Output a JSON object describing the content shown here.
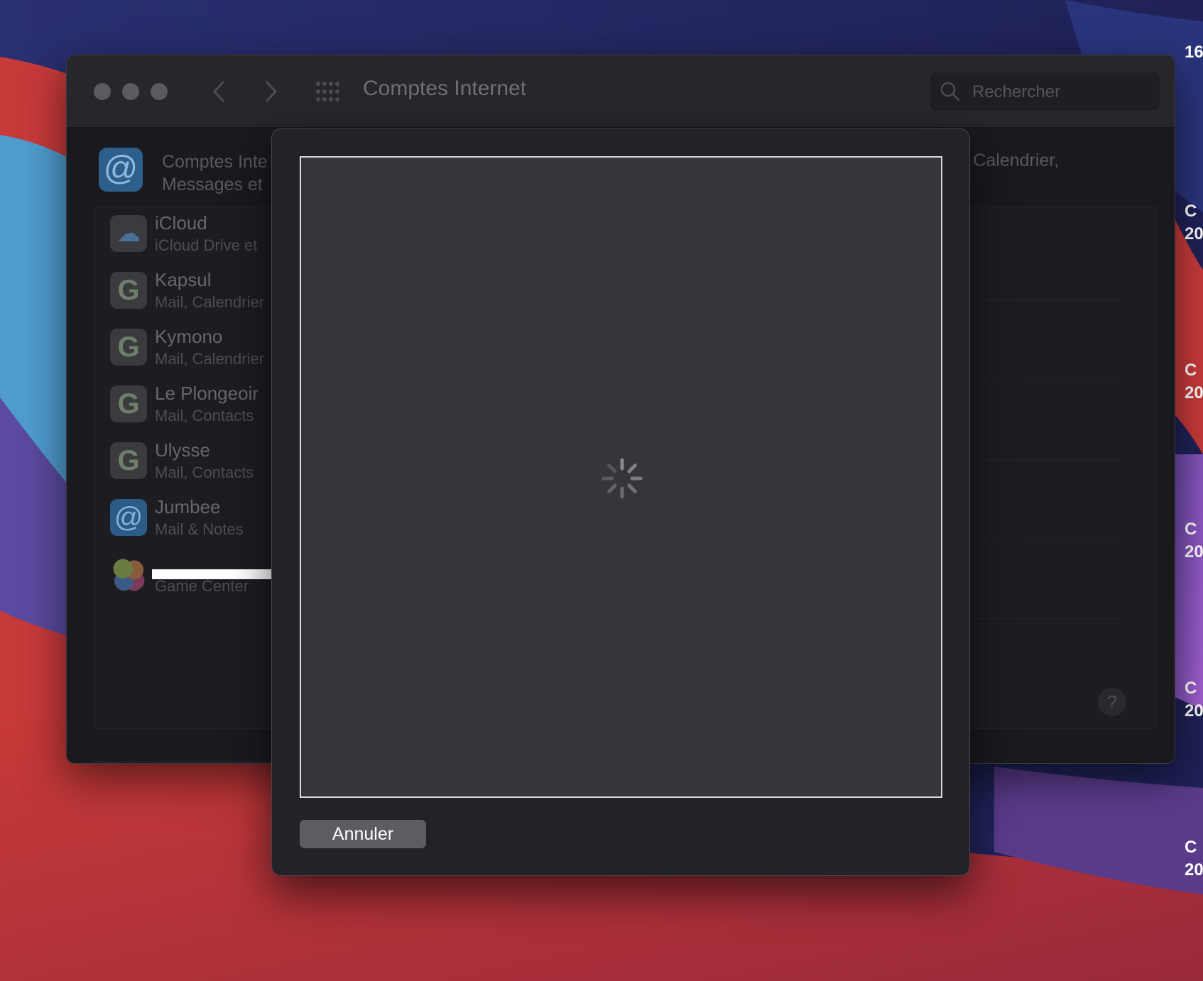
{
  "window": {
    "title": "Comptes Internet",
    "search": {
      "placeholder": "Rechercher"
    }
  },
  "header": {
    "icon": "@",
    "description_left": "Comptes Inte",
    "description_left_line2": "Messages et",
    "description_right": "ts, Calendrier,"
  },
  "accounts": [
    {
      "name": "iCloud",
      "subtitle": "iCloud Drive et",
      "icon": "icloud-icon"
    },
    {
      "name": "Kapsul",
      "subtitle": "Mail, Calendrier",
      "icon": "google-icon"
    },
    {
      "name": "Kymono",
      "subtitle": "Mail, Calendrier",
      "icon": "google-icon"
    },
    {
      "name": "Le Plongeoir",
      "subtitle": "Mail, Contacts",
      "icon": "google-icon"
    },
    {
      "name": "Ulysse",
      "subtitle": "Mail, Contacts",
      "icon": "google-icon"
    },
    {
      "name": "Jumbee",
      "subtitle": "Mail & Notes",
      "icon": "at-icon"
    },
    {
      "name": "",
      "subtitle": "Game Center",
      "icon": "game-center-icon"
    }
  ],
  "toolbar": {
    "add": "+",
    "remove": "—"
  },
  "help": "?",
  "sheet": {
    "cancel_label": "Annuler"
  },
  "desktop": {
    "edge_texts": [
      "16",
      "C",
      "20",
      "C",
      "20",
      "C",
      "20",
      "C",
      "20",
      "C",
      "20"
    ]
  },
  "colors": {
    "window_bg": "#1c1b20",
    "sheet_bg": "#232227",
    "webview_bg": "#36353b",
    "button_bg": "#5d5c62"
  }
}
